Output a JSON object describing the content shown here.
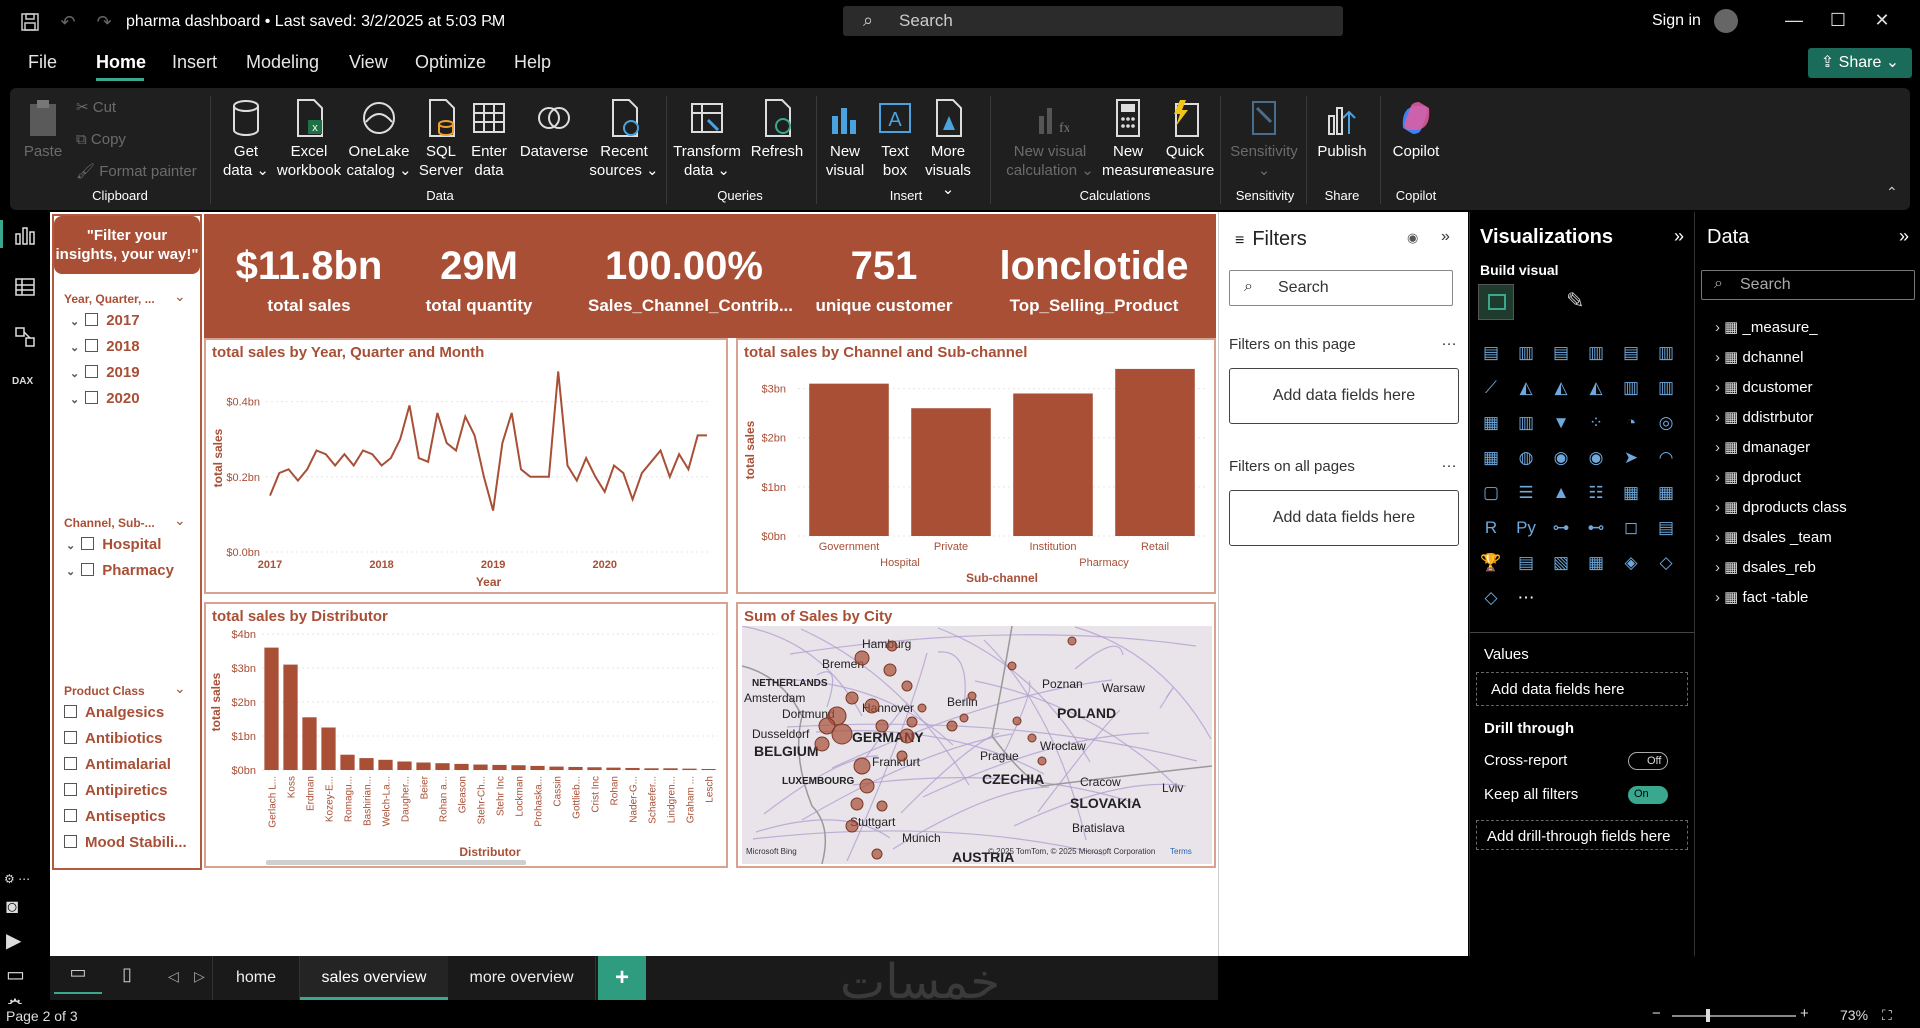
{
  "titlebar": {
    "doc_title": "pharma dashboard • Last saved: 3/2/2025 at 5:03 PM",
    "search_placeholder": "Search",
    "signin_label": "Sign in"
  },
  "menu": {
    "items": [
      "File",
      "Home",
      "Insert",
      "Modeling",
      "View",
      "Optimize",
      "Help"
    ],
    "active": "Home",
    "share_label": "Share"
  },
  "ribbon": {
    "clipboard": {
      "paste": "Paste",
      "cut": "Cut",
      "copy": "Copy",
      "format_painter": "Format painter",
      "group": "Clipboard"
    },
    "data": {
      "get_data": [
        "Get",
        "data ⌄"
      ],
      "excel": [
        "Excel",
        "workbook"
      ],
      "onelake": [
        "OneLake",
        "catalog ⌄"
      ],
      "sql": [
        "SQL",
        "Server"
      ],
      "enter": [
        "Enter",
        "data"
      ],
      "dataverse": [
        "Dataverse",
        ""
      ],
      "recent": [
        "Recent",
        "sources ⌄"
      ],
      "group": "Data"
    },
    "queries": {
      "transform": [
        "Transform",
        "data ⌄"
      ],
      "refresh": [
        "Refresh",
        ""
      ],
      "group": "Queries"
    },
    "insert": {
      "new_visual": [
        "New",
        "visual"
      ],
      "text_box": [
        "Text",
        "box"
      ],
      "more_visuals": [
        "More",
        "visuals ⌄"
      ],
      "group": "Insert"
    },
    "calculations": {
      "new_visual_calc": [
        "New visual",
        "calculation ⌄"
      ],
      "new_measure": [
        "New",
        "measure"
      ],
      "quick_measure": [
        "Quick",
        "measure"
      ],
      "group": "Calculations"
    },
    "sensitivity": {
      "label": [
        "Sensitivity",
        "⌄"
      ],
      "group": "Sensitivity"
    },
    "share": {
      "publish": "Publish",
      "group": "Share"
    },
    "copilot": {
      "label": "Copilot",
      "group": "Copilot"
    }
  },
  "slicers": {
    "header": "\"Filter your insights, your way!\"",
    "year": {
      "title": "Year, Quarter, ...",
      "items": [
        "2017",
        "2018",
        "2019",
        "2020"
      ]
    },
    "channel": {
      "title": "Channel, Sub-...",
      "items": [
        "Hospital",
        "Pharmacy"
      ]
    },
    "product_class": {
      "title": "Product Class",
      "items": [
        "Analgesics",
        "Antibiotics",
        "Antimalarial",
        "Antipiretics",
        "Antiseptics",
        "Mood Stabili..."
      ]
    }
  },
  "kpis": [
    {
      "value": "$11.8bn",
      "label": "total sales"
    },
    {
      "value": "29M",
      "label": "total quantity"
    },
    {
      "value": "100.00%",
      "label": "Sales_Channel_Contrib..."
    },
    {
      "value": "751",
      "label": "unique customer"
    },
    {
      "value": "lonclotide",
      "label": "Top_Selling_Product"
    }
  ],
  "colors": {
    "accent": "#a84f36",
    "pbi_green": "#1a6b5a",
    "canvas": "#ffffff"
  },
  "chart_data": [
    {
      "type": "line",
      "title": "total sales by Year, Quarter and Month",
      "xlabel": "Year",
      "ylabel": "total sales",
      "x_ticks": [
        "2017",
        "2018",
        "2019",
        "2020"
      ],
      "y_ticks": [
        "$0.0bn",
        "$0.2bn",
        "$0.4bn"
      ],
      "ylim": [
        0,
        0.5
      ],
      "values": [
        0.15,
        0.21,
        0.22,
        0.19,
        0.22,
        0.27,
        0.26,
        0.23,
        0.26,
        0.23,
        0.27,
        0.26,
        0.23,
        0.25,
        0.3,
        0.39,
        0.25,
        0.24,
        0.37,
        0.29,
        0.27,
        0.36,
        0.31,
        0.2,
        0.11,
        0.29,
        0.37,
        0.22,
        0.2,
        0.2,
        0.2,
        0.48,
        0.23,
        0.19,
        0.25,
        0.2,
        0.16,
        0.23,
        0.21,
        0.14,
        0.21,
        0.24,
        0.27,
        0.2,
        0.26,
        0.22,
        0.31,
        0.31
      ]
    },
    {
      "type": "bar",
      "title": "total sales by Channel and Sub-channel",
      "xlabel": "Sub-channel",
      "ylabel": "total sales",
      "categories": [
        "Government",
        "Private",
        "Institution",
        "Retail"
      ],
      "groups": [
        "Hospital",
        "Pharmacy"
      ],
      "values": [
        3.1,
        2.6,
        2.9,
        3.4
      ],
      "y_ticks": [
        "$0bn",
        "$1bn",
        "$2bn",
        "$3bn"
      ],
      "ylim": [
        0,
        3.5
      ]
    },
    {
      "type": "bar",
      "title": "total sales by Distributor",
      "xlabel": "Distributor",
      "ylabel": "total sales",
      "categories": [
        "Gerlach L...",
        "Koss",
        "Erdman",
        "Kozey-E...",
        "Romagu...",
        "Bashirian...",
        "Welch-La...",
        "Daugher...",
        "Beier",
        "Rohan a...",
        "Gleason",
        "Stehr-Ch...",
        "Stehr Inc",
        "Lockman",
        "Prohaska...",
        "Cassin",
        "Gottlieb...",
        "Crist Inc",
        "Rohan",
        "Nader-G...",
        "Schaefer...",
        "Lindgren...",
        "Graham ...",
        "Lesch"
      ],
      "values": [
        3.6,
        3.1,
        1.55,
        1.25,
        0.45,
        0.35,
        0.3,
        0.25,
        0.22,
        0.2,
        0.18,
        0.16,
        0.15,
        0.14,
        0.12,
        0.1,
        0.09,
        0.08,
        0.07,
        0.06,
        0.05,
        0.05,
        0.04,
        0.03
      ],
      "y_ticks": [
        "$0bn",
        "$1bn",
        "$2bn",
        "$3bn",
        "$4bn"
      ],
      "ylim": [
        0,
        4
      ]
    }
  ],
  "map": {
    "title": "Sum of Sales by City",
    "labels": [
      "Hamburg",
      "Bremen",
      "NETHERLANDS",
      "Amsterdam",
      "Dortmund",
      "Hannover",
      "Berlin",
      "Poznan",
      "Warsaw",
      "POLAND",
      "Dusseldorf",
      "GERMANY",
      "BELGIUM",
      "Wroclaw",
      "Frankfurt",
      "Prague",
      "LUXEMBOURG",
      "CZECHIA",
      "Cracow",
      "SLOVAKIA",
      "Lviv",
      "Stuttgart",
      "Munich",
      "Bratislava",
      "AUSTRIA"
    ],
    "attribution": "© 2025 TomTom, © 2025 Microsoft Corporation",
    "terms": "Terms",
    "bing": "Microsoft Bing"
  },
  "filters": {
    "title": "Filters",
    "search_placeholder": "Search",
    "on_page": "Filters on this page",
    "on_all_pages": "Filters on all pages",
    "add_fields": "Add data fields here"
  },
  "visualizations": {
    "title": "Visualizations",
    "build_visual": "Build visual",
    "values_label": "Values",
    "add_fields": "Add data fields here",
    "drill_through": "Drill through",
    "cross_report": "Cross-report",
    "cross_report_state": "Off",
    "keep_all_filters": "Keep all filters",
    "keep_all_filters_state": "On",
    "add_drill": "Add drill-through fields here"
  },
  "data_pane": {
    "title": "Data",
    "search_placeholder": "Search",
    "tables": [
      "_measure_",
      "dchannel",
      "dcustomer",
      "ddistrbutor",
      "dmanager",
      "dproduct",
      "dproducts class",
      "dsales _team",
      "dsales_reb",
      "fact -table"
    ]
  },
  "pages": {
    "tabs": [
      "home",
      "sales overview",
      "more overview"
    ],
    "active": "sales overview",
    "add": "+"
  },
  "status": {
    "page_info": "Page 2 of 3",
    "zoom": "73%",
    "watermark": "خمسات"
  }
}
